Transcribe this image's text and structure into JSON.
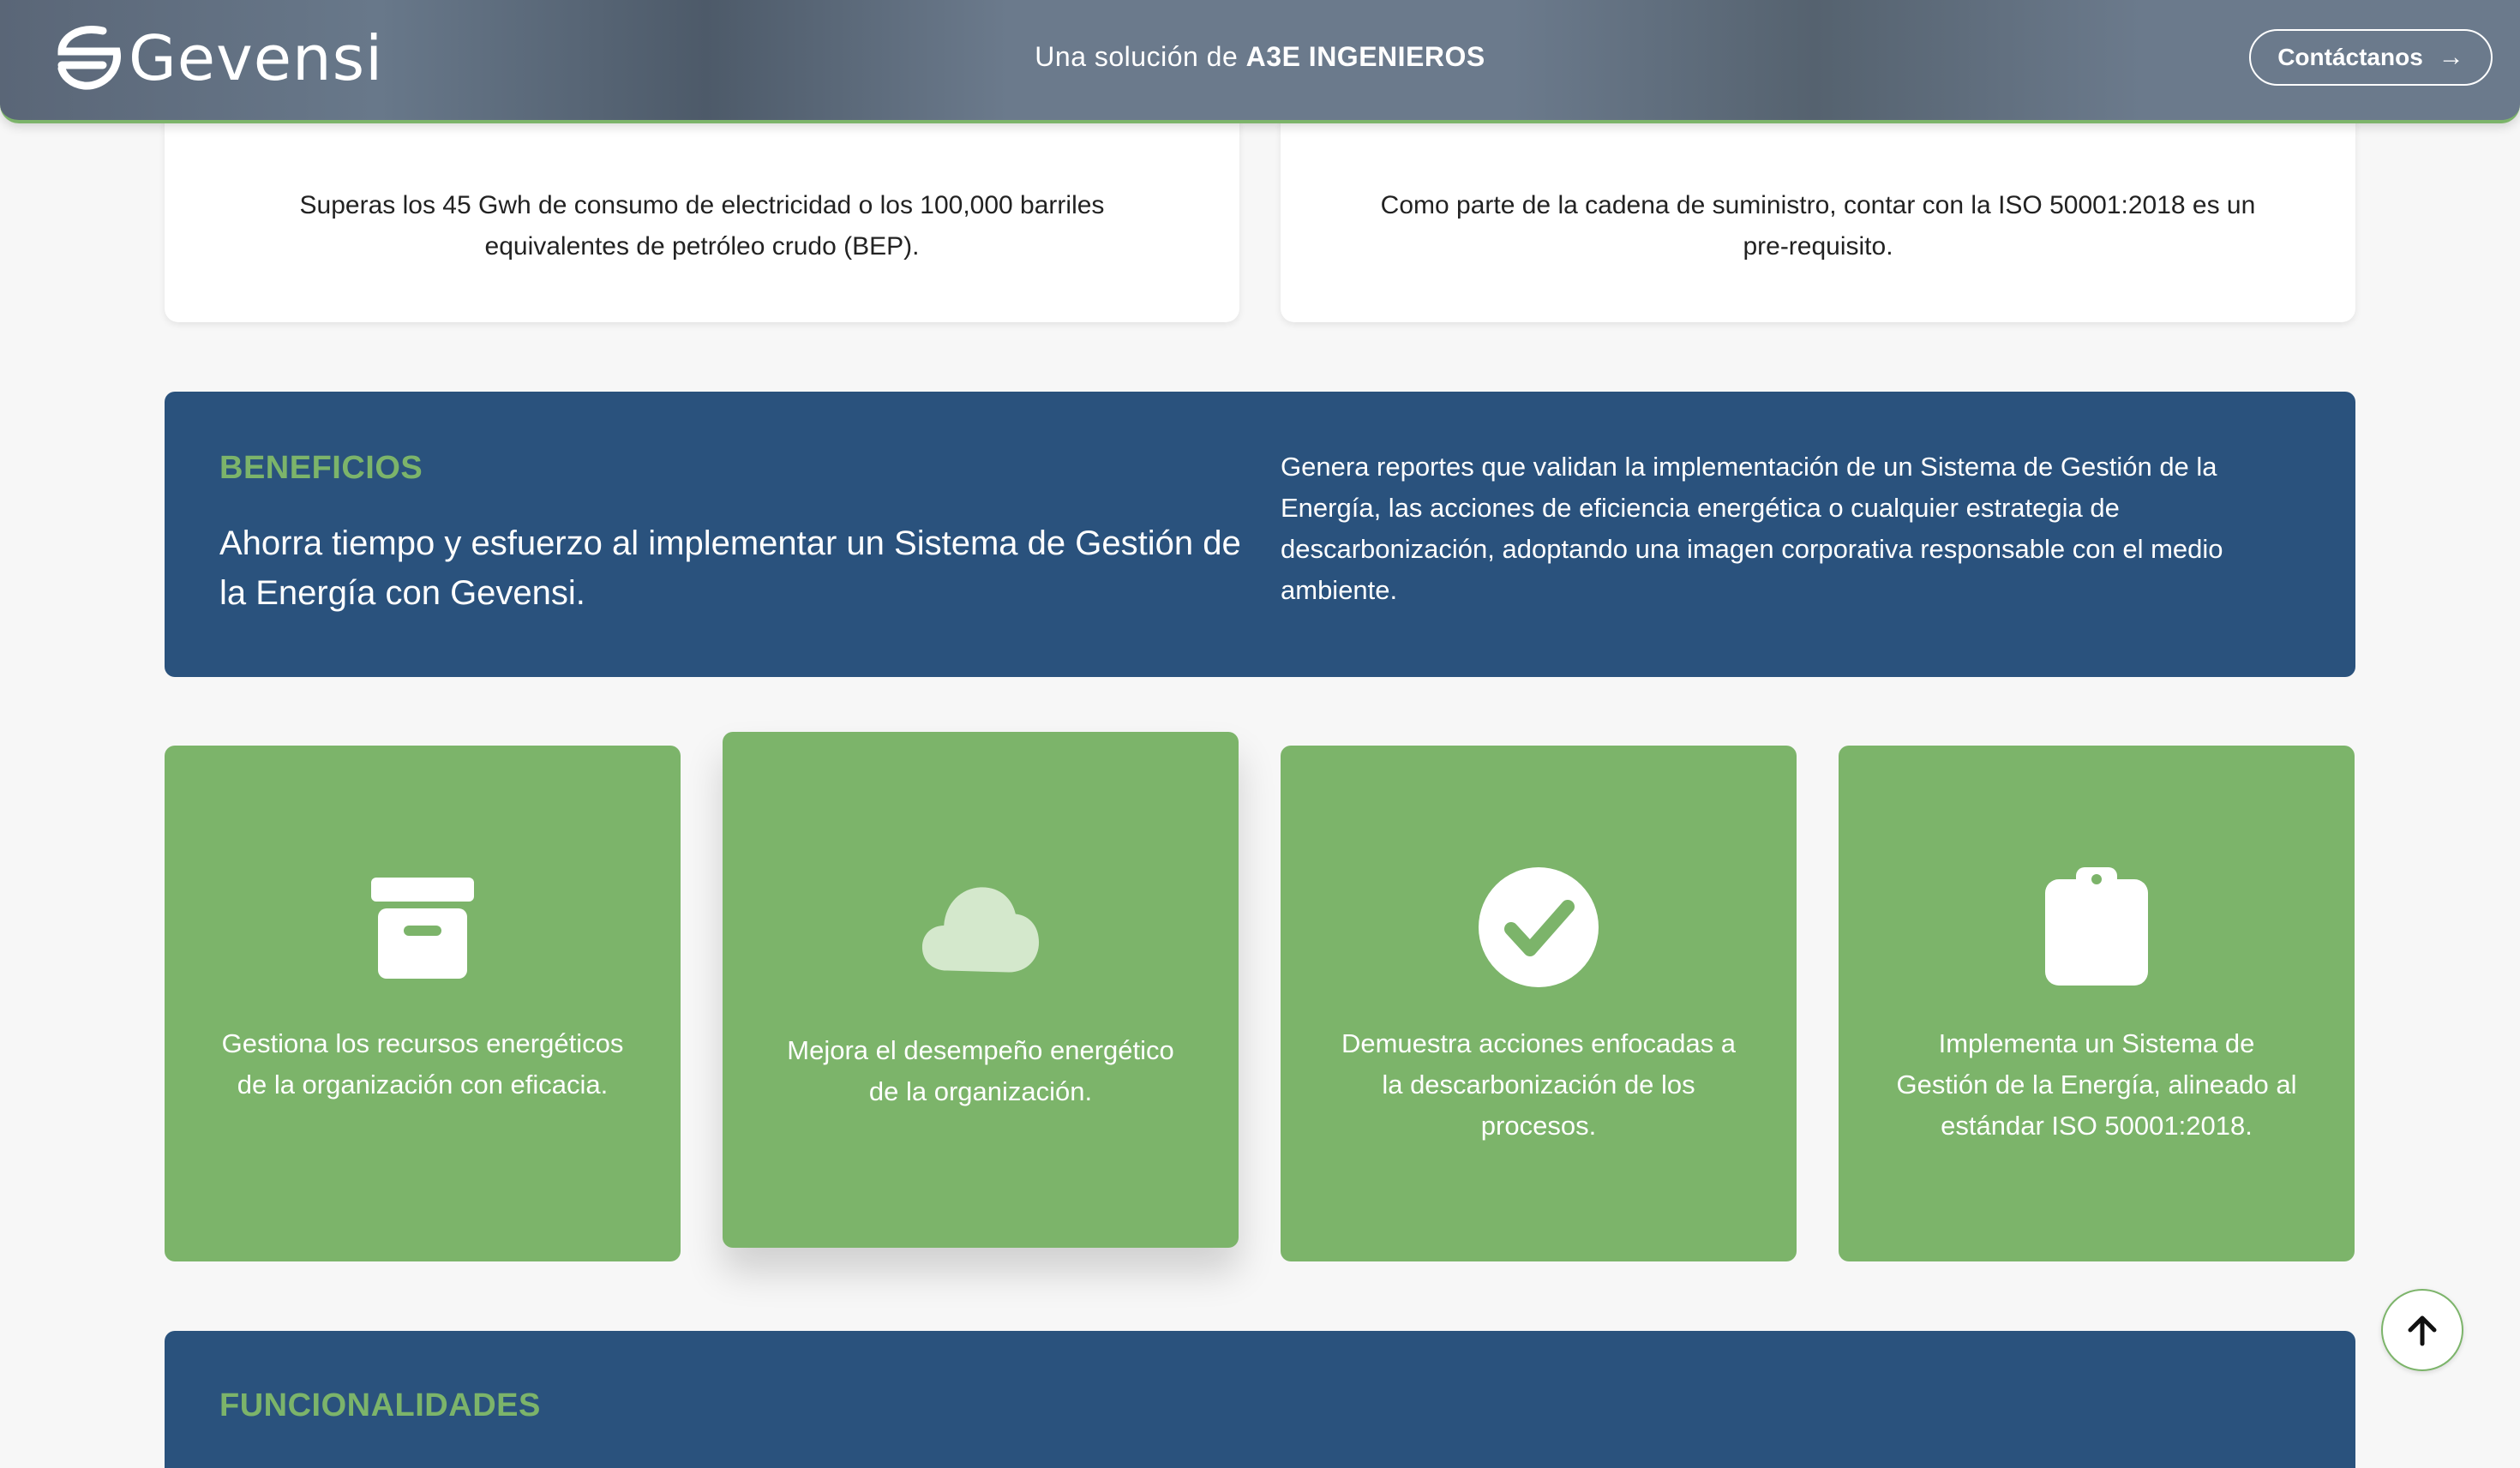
{
  "header": {
    "logo_text": "Gevensi",
    "tagline_prefix": "Una solución de",
    "tagline_company": "A3E INGENIEROS",
    "contact_label": "Contáctanos"
  },
  "top_cards": [
    {
      "text": "Superas los 45 Gwh de consumo de electricidad o los 100,000 barriles equivalentes de petróleo crudo (BEP)."
    },
    {
      "text": "Como parte de la cadena de suministro, contar con la ISO 50001:2018 es un pre-requisito."
    }
  ],
  "benefits": {
    "label": "BENEFICIOS",
    "title": "Ahorra tiempo y esfuerzo al implementar un Sistema de Gestión de la Energía con Gevensi.",
    "description": "Genera reportes que validan la implementación de un Sistema de Gestión de la Energía, las acciones de eficiencia energética o cualquier estrategia de descarbonización, adoptando una imagen corporativa responsable con el medio ambiente."
  },
  "benefit_cards": [
    {
      "icon": "archive-box-icon",
      "text": "Gestiona los recursos energéticos de la organización con eficacia."
    },
    {
      "icon": "cloud-icon",
      "text": "Mejora el desempeño energético de la organización."
    },
    {
      "icon": "check-circle-icon",
      "text": "Demuestra acciones enfocadas a la descarbonización de los procesos."
    },
    {
      "icon": "clipboard-icon",
      "text": "Implementa un Sistema de Gestión de la Energía, alineado al estándar ISO 50001:2018."
    }
  ],
  "functionalities": {
    "label": "FUNCIONALIDADES"
  },
  "colors": {
    "header_bg": "#6b7a8c",
    "accent_green": "#7cb46a",
    "banner_blue": "#2a527d",
    "page_bg": "#f7f7f7"
  }
}
